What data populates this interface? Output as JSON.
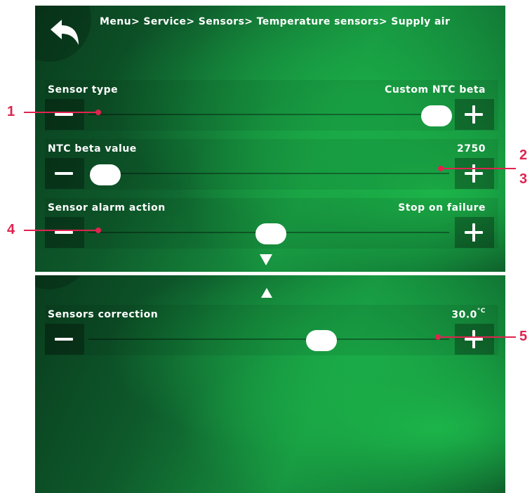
{
  "breadcrumb": "Menu> Service> Sensors> Temperature sensors> Supply air",
  "rows": [
    {
      "label": "Sensor type",
      "value": "Custom NTC beta"
    },
    {
      "label": "NTC beta value",
      "value": "2750"
    },
    {
      "label": "Sensor alarm action",
      "value": "Stop on failure"
    },
    {
      "label": "Sensors correction",
      "value": "30.0",
      "unit": "°C"
    }
  ],
  "callouts": [
    "1",
    "2",
    "3",
    "4",
    "5"
  ],
  "icons": {
    "back": "back-arrow-icon",
    "minus": "minus-icon",
    "plus": "plus-icon",
    "scroll_down": "triangle-down-icon",
    "scroll_up": "triangle-up-icon"
  },
  "colors": {
    "accent_green": "#17913f",
    "callout": "#e0234f"
  }
}
